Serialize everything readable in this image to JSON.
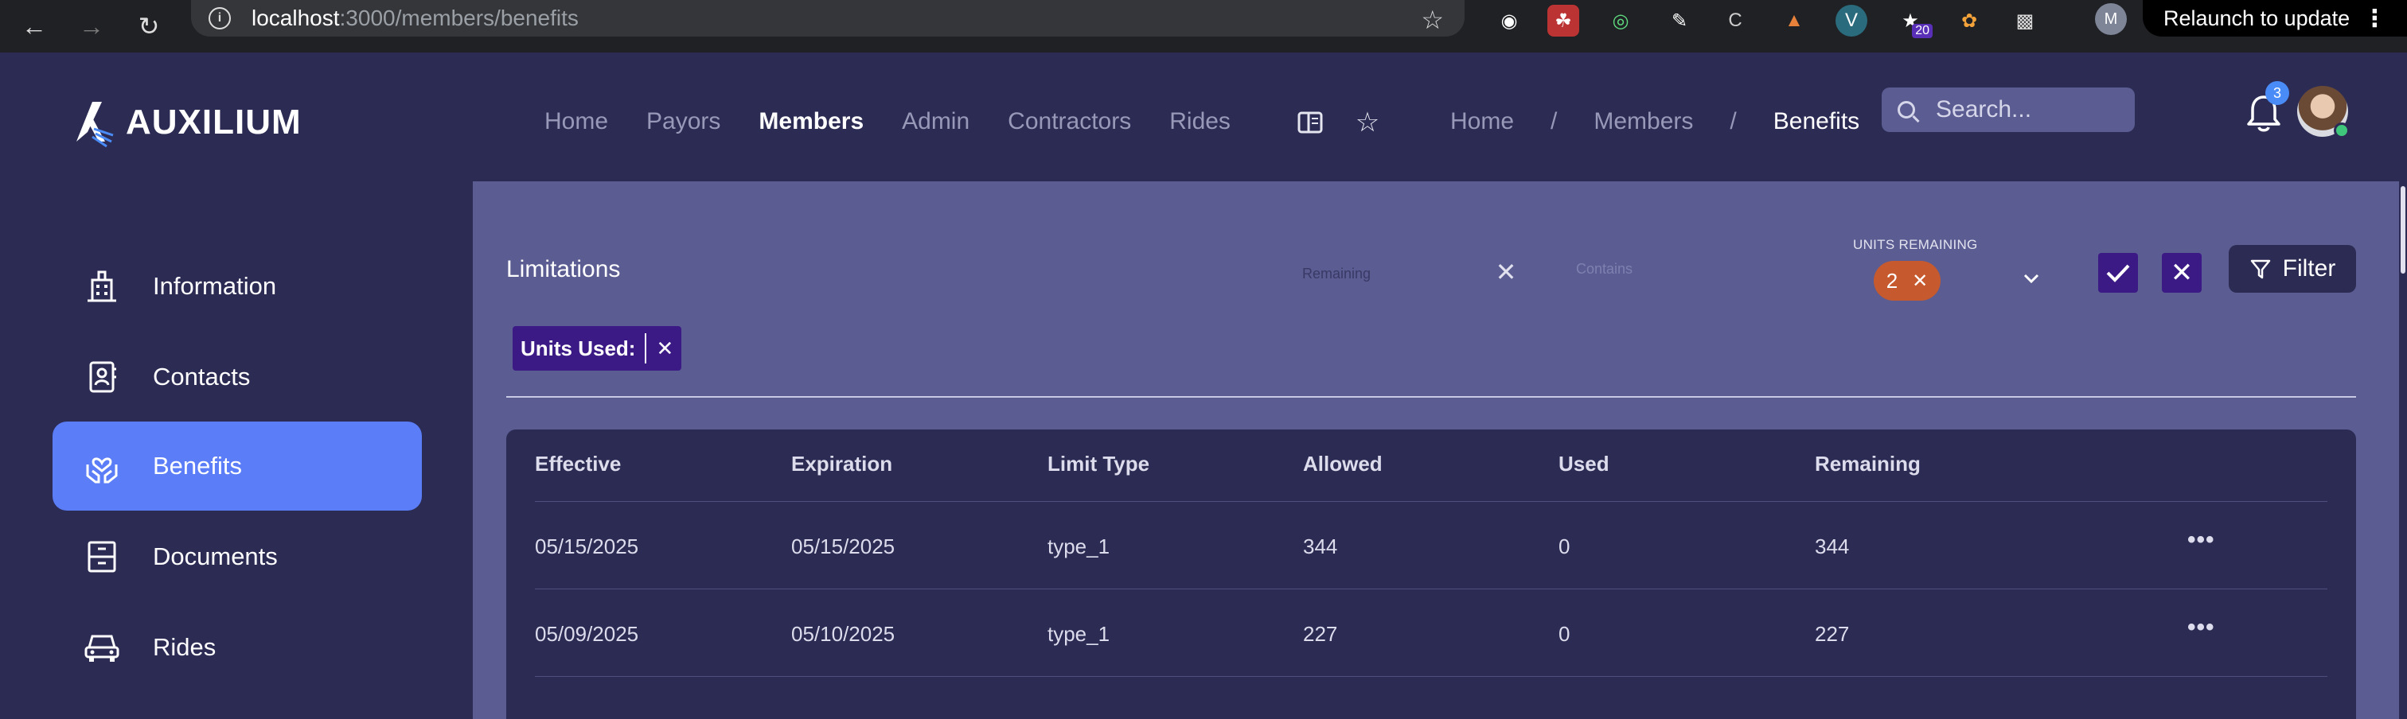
{
  "browser": {
    "url_host": "localhost",
    "url_path": ":3000/members/benefits",
    "relaunch_label": "Relaunch to update",
    "profile_initial": "M",
    "extension_badge": "20"
  },
  "header": {
    "brand": "AUXILIUM",
    "nav": [
      "Home",
      "Payors",
      "Members",
      "Admin",
      "Contractors",
      "Rides"
    ],
    "nav_active": "Members",
    "breadcrumb": [
      "Home",
      "Members",
      "Benefits"
    ],
    "breadcrumb_sep": "/",
    "search_placeholder": "Search...",
    "notification_count": "3"
  },
  "sidebar": {
    "items": [
      {
        "label": "Information",
        "icon": "building-icon"
      },
      {
        "label": "Contacts",
        "icon": "contact-book-icon"
      },
      {
        "label": "Benefits",
        "icon": "hands-heart-icon"
      },
      {
        "label": "Documents",
        "icon": "archive-box-icon"
      },
      {
        "label": "Rides",
        "icon": "car-icon"
      }
    ],
    "active": "Benefits"
  },
  "limitations": {
    "title": "Limitations",
    "field_remaining_placeholder": "Remaining",
    "field_contains_placeholder": "Contains",
    "units_remaining_label": "UNITS REMAINING",
    "units_remaining_value": "2",
    "filter_label": "Filter",
    "tag_label": "Units Used:"
  },
  "table": {
    "columns": [
      "Effective",
      "Expiration",
      "Limit Type",
      "Allowed",
      "Used",
      "Remaining"
    ],
    "rows": [
      [
        "05/15/2025",
        "05/15/2025",
        "type_1",
        "344",
        "0",
        "344"
      ],
      [
        "05/09/2025",
        "05/10/2025",
        "type_1",
        "227",
        "0",
        "227"
      ]
    ]
  },
  "colors": {
    "background": "#2c2b54",
    "panel": "#5b5c91",
    "active_item": "#5b7df7",
    "accent_purple": "#3c1a86",
    "chip_orange": "#c65a2e"
  }
}
